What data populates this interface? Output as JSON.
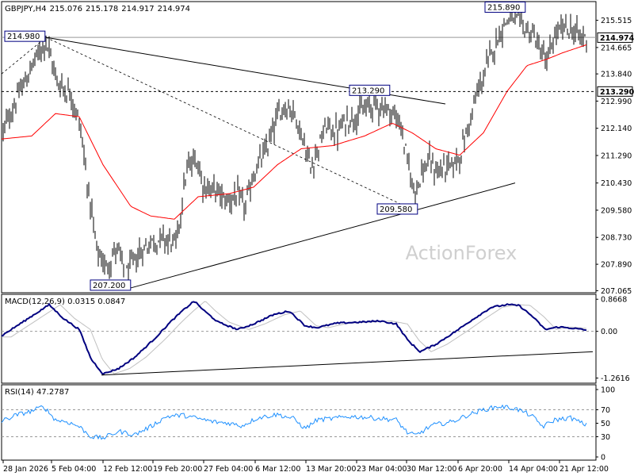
{
  "header": {
    "symbol": "GBPJPY,H4",
    "ohlc": [
      "215.076",
      "215.178",
      "214.917",
      "214.974"
    ]
  },
  "watermark": "ActionForex",
  "colors": {
    "background": "#ffffff",
    "bars": "#000000",
    "moving_average": "#ff0000",
    "macd_line": "#000080",
    "signal_line": "#c0c0c0",
    "box_border": "#000080",
    "watermark": "#cfcfcf"
  },
  "chart_data": [
    {
      "type": "ohlc",
      "panel": "price",
      "yticks": [
        "215.515",
        "214.665",
        "213.840",
        "212.990",
        "212.140",
        "211.290",
        "210.430",
        "209.580",
        "208.730",
        "207.890",
        "207.065"
      ],
      "ylim": [
        207.0,
        216.1
      ],
      "price_boxes": [
        "214.980",
        "213.290",
        "215.890",
        "209.580",
        "207.200",
        "214.974",
        "213.290"
      ],
      "levels": [
        214.98,
        213.29
      ],
      "trendlines": [
        "resistance",
        "support",
        "dashed channel"
      ],
      "anchor_closes": [
        [
          0,
          211.8
        ],
        [
          20,
          213.0
        ],
        [
          45,
          214.3
        ],
        [
          58,
          214.9
        ],
        [
          72,
          213.6
        ],
        [
          90,
          213.2
        ],
        [
          102,
          212.1
        ],
        [
          112,
          210.1
        ],
        [
          122,
          208.3
        ],
        [
          133,
          207.8
        ],
        [
          148,
          208.4
        ],
        [
          158,
          207.5
        ],
        [
          172,
          208.1
        ],
        [
          190,
          208.6
        ],
        [
          208,
          208.7
        ],
        [
          222,
          208.5
        ],
        [
          235,
          210.8
        ],
        [
          248,
          211.2
        ],
        [
          258,
          210.3
        ],
        [
          272,
          210.2
        ],
        [
          285,
          209.9
        ],
        [
          298,
          210.0
        ],
        [
          310,
          209.7
        ],
        [
          320,
          210.7
        ],
        [
          335,
          211.4
        ],
        [
          350,
          212.5
        ],
        [
          360,
          212.9
        ],
        [
          372,
          212.6
        ],
        [
          382,
          211.8
        ],
        [
          392,
          210.9
        ],
        [
          402,
          211.6
        ],
        [
          412,
          212.2
        ],
        [
          425,
          212.0
        ],
        [
          438,
          212.4
        ],
        [
          452,
          212.6
        ],
        [
          465,
          212.8
        ],
        [
          478,
          212.9
        ],
        [
          492,
          212.7
        ],
        [
          505,
          212.3
        ],
        [
          515,
          211.0
        ],
        [
          522,
          210.2
        ],
        [
          530,
          210.6
        ],
        [
          540,
          211.1
        ],
        [
          552,
          210.8
        ],
        [
          562,
          210.9
        ],
        [
          572,
          211.0
        ],
        [
          582,
          211.4
        ],
        [
          592,
          212.3
        ],
        [
          602,
          213.2
        ],
        [
          612,
          213.9
        ],
        [
          622,
          214.6
        ],
        [
          632,
          215.2
        ],
        [
          642,
          215.6
        ],
        [
          652,
          215.5
        ],
        [
          662,
          215.3
        ],
        [
          672,
          215.1
        ],
        [
          682,
          214.6
        ],
        [
          690,
          214.2
        ],
        [
          700,
          215.0
        ],
        [
          712,
          215.3
        ],
        [
          722,
          215.2
        ],
        [
          732,
          215.0
        ],
        [
          740,
          214.97
        ]
      ],
      "moving_average_anchors": [
        [
          0,
          211.8
        ],
        [
          40,
          211.9
        ],
        [
          70,
          212.6
        ],
        [
          100,
          212.5
        ],
        [
          130,
          211.0
        ],
        [
          165,
          209.7
        ],
        [
          190,
          209.4
        ],
        [
          220,
          209.3
        ],
        [
          250,
          210.0
        ],
        [
          290,
          210.1
        ],
        [
          320,
          210.3
        ],
        [
          350,
          211.0
        ],
        [
          380,
          211.5
        ],
        [
          420,
          211.6
        ],
        [
          460,
          211.9
        ],
        [
          495,
          212.3
        ],
        [
          520,
          212.0
        ],
        [
          550,
          211.5
        ],
        [
          580,
          211.3
        ],
        [
          610,
          212.0
        ],
        [
          640,
          213.3
        ],
        [
          665,
          214.1
        ],
        [
          690,
          214.3
        ],
        [
          710,
          214.5
        ],
        [
          740,
          214.75
        ]
      ]
    },
    {
      "type": "line",
      "panel": "macd",
      "label": "MACD(12,26,9) 0.0315 0.0847",
      "yticks": [
        "0.8668",
        "0.00",
        "-1.2616"
      ],
      "ylim": [
        -1.4,
        1.0
      ],
      "macd_anchors": [
        [
          0,
          -0.15
        ],
        [
          25,
          0.2
        ],
        [
          50,
          0.55
        ],
        [
          62,
          0.72
        ],
        [
          80,
          0.35
        ],
        [
          100,
          0.05
        ],
        [
          115,
          -0.75
        ],
        [
          130,
          -1.15
        ],
        [
          150,
          -1.0
        ],
        [
          170,
          -0.7
        ],
        [
          195,
          -0.2
        ],
        [
          215,
          0.25
        ],
        [
          230,
          0.55
        ],
        [
          245,
          0.82
        ],
        [
          258,
          0.55
        ],
        [
          275,
          0.25
        ],
        [
          300,
          0.05
        ],
        [
          320,
          0.2
        ],
        [
          345,
          0.45
        ],
        [
          365,
          0.55
        ],
        [
          385,
          0.15
        ],
        [
          400,
          0.1
        ],
        [
          425,
          0.22
        ],
        [
          455,
          0.25
        ],
        [
          480,
          0.28
        ],
        [
          500,
          0.2
        ],
        [
          515,
          -0.25
        ],
        [
          530,
          -0.55
        ],
        [
          550,
          -0.35
        ],
        [
          575,
          0.0
        ],
        [
          595,
          0.3
        ],
        [
          620,
          0.65
        ],
        [
          640,
          0.72
        ],
        [
          655,
          0.7
        ],
        [
          672,
          0.4
        ],
        [
          688,
          0.05
        ],
        [
          705,
          0.12
        ],
        [
          725,
          0.08
        ],
        [
          740,
          0.03
        ]
      ]
    },
    {
      "type": "line",
      "panel": "rsi",
      "label": "RSI(14) 47.2787",
      "yticks": [
        "100",
        "70",
        "50",
        "30",
        "0"
      ],
      "ylim": [
        0,
        100
      ],
      "rsi_anchors": [
        [
          0,
          52
        ],
        [
          20,
          62
        ],
        [
          40,
          68
        ],
        [
          55,
          75
        ],
        [
          70,
          55
        ],
        [
          85,
          52
        ],
        [
          100,
          45
        ],
        [
          115,
          30
        ],
        [
          130,
          28
        ],
        [
          150,
          38
        ],
        [
          170,
          33
        ],
        [
          190,
          45
        ],
        [
          210,
          60
        ],
        [
          230,
          62
        ],
        [
          250,
          57
        ],
        [
          270,
          52
        ],
        [
          290,
          50
        ],
        [
          305,
          46
        ],
        [
          325,
          58
        ],
        [
          350,
          63
        ],
        [
          370,
          57
        ],
        [
          385,
          42
        ],
        [
          400,
          55
        ],
        [
          420,
          57
        ],
        [
          440,
          60
        ],
        [
          460,
          59
        ],
        [
          480,
          57
        ],
        [
          500,
          55
        ],
        [
          515,
          35
        ],
        [
          525,
          32
        ],
        [
          545,
          47
        ],
        [
          570,
          52
        ],
        [
          590,
          62
        ],
        [
          610,
          70
        ],
        [
          630,
          75
        ],
        [
          650,
          72
        ],
        [
          670,
          62
        ],
        [
          685,
          45
        ],
        [
          700,
          55
        ],
        [
          720,
          58
        ],
        [
          740,
          47
        ]
      ]
    }
  ],
  "x_axis_labels": [
    "28 Jan 2026",
    "5 Feb 04:00",
    "12 Feb 12:00",
    "19 Feb 20:00",
    "27 Feb 04:00",
    "6 Mar 12:00",
    "13 Mar 20:00",
    "23 Mar 04:00",
    "30 Mar 12:00",
    "6 Apr 20:00",
    "14 Apr 04:00",
    "21 Apr 12:00"
  ]
}
